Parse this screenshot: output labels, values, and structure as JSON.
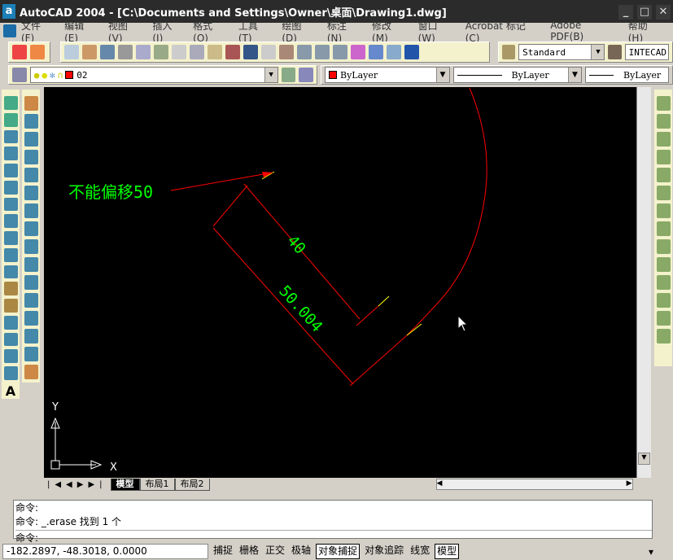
{
  "window": {
    "title": "AutoCAD 2004 - [C:\\Documents and Settings\\Owner\\桌面\\Drawing1.dwg]"
  },
  "menu": [
    "文件(F)",
    "编辑(E)",
    "视图(V)",
    "插入(I)",
    "格式(O)",
    "工具(T)",
    "绘图(D)",
    "标注(N)",
    "修改(M)",
    "窗口(W)",
    "Acrobat 标记(C)",
    "Adobe PDF(B)",
    "帮助(H)"
  ],
  "toolbar": {
    "text_style": "Standard",
    "dim_style": "INTECAD"
  },
  "layers": {
    "current_layer": "02",
    "color": "ByLayer",
    "linetype": "ByLayer",
    "lineweight": "ByLayer",
    "layer_color": "#ff0000"
  },
  "drawing": {
    "annotation": "不能偏移50",
    "dim_40": "40",
    "dim_50": "50.004",
    "ucs_x": "X",
    "ucs_y": "Y"
  },
  "layout_tabs": [
    "模型",
    "布局1",
    "布局2"
  ],
  "command": {
    "history": [
      "命令:",
      "命令: _.erase 找到 1 个"
    ],
    "prompt": "命令:"
  },
  "status": {
    "coords": "-182.2897, -48.3018, 0.0000",
    "buttons": [
      {
        "label": "捕捉",
        "on": false
      },
      {
        "label": "栅格",
        "on": false
      },
      {
        "label": "正交",
        "on": false
      },
      {
        "label": "极轴",
        "on": false
      },
      {
        "label": "对象捕捉",
        "on": true
      },
      {
        "label": "对象追踪",
        "on": false
      },
      {
        "label": "线宽",
        "on": false
      },
      {
        "label": "模型",
        "on": true
      }
    ]
  }
}
